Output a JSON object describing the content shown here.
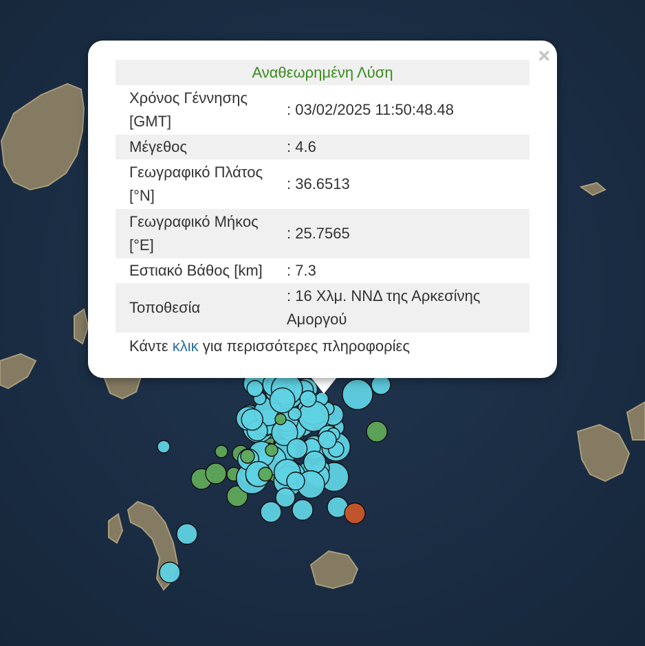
{
  "popup": {
    "close_symbol": "×",
    "header": "Αναθεωρημένη Λύση",
    "rows": [
      {
        "label": "Χρόνος Γέννησης [GMT]",
        "value": ": 03/02/2025 11:50:48.48"
      },
      {
        "label": "Μέγεθος",
        "value": ": 4.6"
      },
      {
        "label": "Γεωγραφικό Πλάτος [°N]",
        "value": ": 36.6513"
      },
      {
        "label": "Γεωγραφικό Μήκος [°E]",
        "value": ": 25.7565"
      },
      {
        "label": "Εστιακό Βάθος [km]",
        "value": ": 7.3"
      },
      {
        "label": "Τοποθεσία",
        "value": ": 16 Χλμ. ΝΝΔ της Αρκεσίνης Αμοργού"
      }
    ],
    "more_prefix": "Κάντε ",
    "more_link": "κλικ",
    "more_suffix": " για περισσότερες πληροφορίες"
  },
  "colors": {
    "sea": "#1c3045",
    "land": "#7d7560",
    "marker_cyan": "#5fd2e3",
    "marker_green": "#5fa85a",
    "marker_orange": "#c9572b",
    "header_green": "#3a8a1e",
    "link_blue": "#2a6f9a"
  },
  "map": {
    "marker_categories": [
      "cyan",
      "green",
      "orange"
    ]
  }
}
